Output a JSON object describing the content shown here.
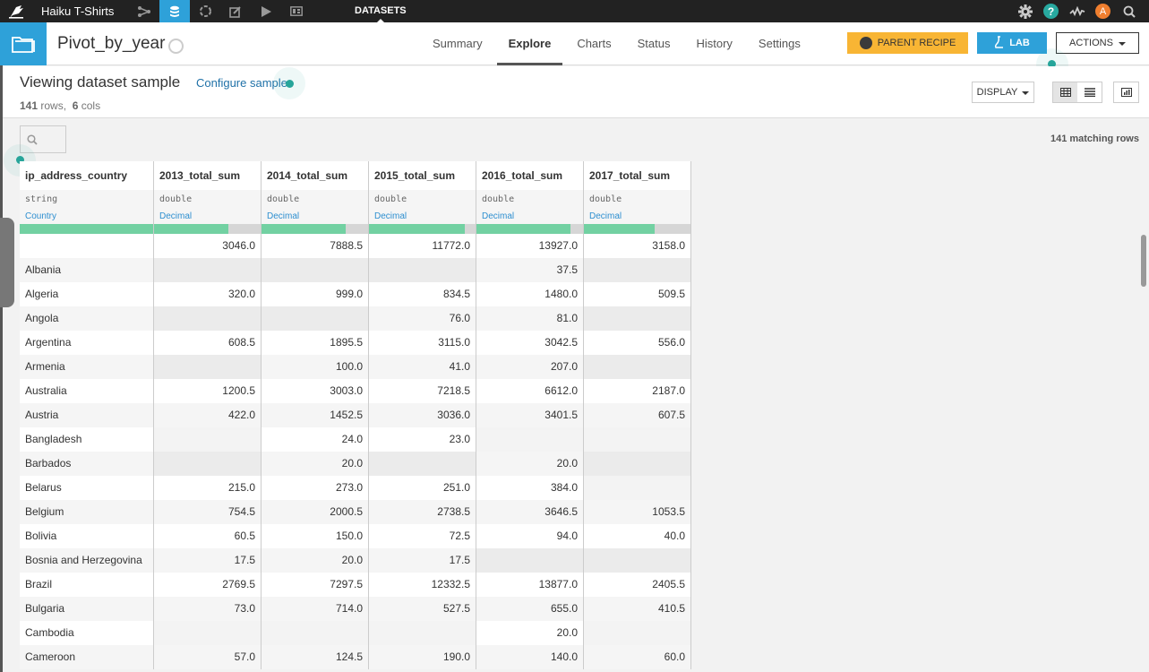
{
  "topnav": {
    "project_name": "Haiku T-Shirts",
    "section": "DATASETS",
    "icons": [
      "flow-icon",
      "datasets-icon",
      "recipes-icon",
      "notebooks-icon",
      "jobs-icon",
      "dashboards-icon"
    ],
    "active_icon": "datasets-icon",
    "right_icons": [
      "gear-icon",
      "help-icon",
      "activity-icon",
      "avatar-icon",
      "search-icon"
    ],
    "avatar_initial": "A",
    "help_label": "?"
  },
  "header": {
    "dataset_name": "Pivot_by_year",
    "tabs": [
      {
        "label": "Summary",
        "active": false
      },
      {
        "label": "Explore",
        "active": true
      },
      {
        "label": "Charts",
        "active": false
      },
      {
        "label": "Status",
        "active": false
      },
      {
        "label": "History",
        "active": false
      },
      {
        "label": "Settings",
        "active": false
      }
    ],
    "parent_recipe_label": "PARENT RECIPE",
    "lab_label": "LAB",
    "actions_label": "ACTIONS"
  },
  "sample": {
    "title": "Viewing dataset sample",
    "configure_label": "Configure sample",
    "rows_count": "141",
    "rows_label": "rows,",
    "cols_count": "6",
    "cols_label": "cols",
    "display_label": "DISPLAY",
    "matching_rows": "141 matching rows"
  },
  "table": {
    "columns": [
      {
        "name": "ip_address_country",
        "type": "string",
        "meaning": "Country",
        "valid_fraction": 1.0
      },
      {
        "name": "2013_total_sum",
        "type": "double",
        "meaning": "Decimal",
        "valid_fraction": 0.7
      },
      {
        "name": "2014_total_sum",
        "type": "double",
        "meaning": "Decimal",
        "valid_fraction": 0.79
      },
      {
        "name": "2015_total_sum",
        "type": "double",
        "meaning": "Decimal",
        "valid_fraction": 0.9
      },
      {
        "name": "2016_total_sum",
        "type": "double",
        "meaning": "Decimal",
        "valid_fraction": 0.88
      },
      {
        "name": "2017_total_sum",
        "type": "double",
        "meaning": "Decimal",
        "valid_fraction": 0.66
      }
    ],
    "rows": [
      [
        "",
        "3046.0",
        "7888.5",
        "11772.0",
        "13927.0",
        "3158.0"
      ],
      [
        "Albania",
        "",
        "",
        "",
        "37.5",
        ""
      ],
      [
        "Algeria",
        "320.0",
        "999.0",
        "834.5",
        "1480.0",
        "509.5"
      ],
      [
        "Angola",
        "",
        "",
        "76.0",
        "81.0",
        ""
      ],
      [
        "Argentina",
        "608.5",
        "1895.5",
        "3115.0",
        "3042.5",
        "556.0"
      ],
      [
        "Armenia",
        "",
        "100.0",
        "41.0",
        "207.0",
        ""
      ],
      [
        "Australia",
        "1200.5",
        "3003.0",
        "7218.5",
        "6612.0",
        "2187.0"
      ],
      [
        "Austria",
        "422.0",
        "1452.5",
        "3036.0",
        "3401.5",
        "607.5"
      ],
      [
        "Bangladesh",
        "",
        "24.0",
        "23.0",
        "",
        ""
      ],
      [
        "Barbados",
        "",
        "20.0",
        "",
        "20.0",
        ""
      ],
      [
        "Belarus",
        "215.0",
        "273.0",
        "251.0",
        "384.0",
        ""
      ],
      [
        "Belgium",
        "754.5",
        "2000.5",
        "2738.5",
        "3646.5",
        "1053.5"
      ],
      [
        "Bolivia",
        "60.5",
        "150.0",
        "72.5",
        "94.0",
        "40.0"
      ],
      [
        "Bosnia and Herzegovina",
        "17.5",
        "20.0",
        "17.5",
        "",
        ""
      ],
      [
        "Brazil",
        "2769.5",
        "7297.5",
        "12332.5",
        "13877.0",
        "2405.5"
      ],
      [
        "Bulgaria",
        "73.0",
        "714.0",
        "527.5",
        "655.0",
        "410.5"
      ],
      [
        "Cambodia",
        "",
        "",
        "",
        "20.0",
        ""
      ],
      [
        "Cameroon",
        "57.0",
        "124.5",
        "190.0",
        "140.0",
        "60.0"
      ]
    ]
  }
}
